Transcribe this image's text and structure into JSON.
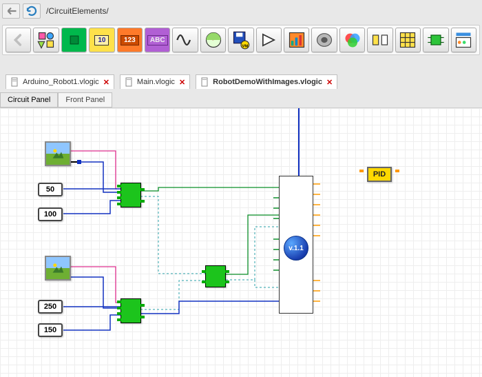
{
  "path": "/CircuitElements/",
  "tabs": [
    {
      "label": "Arduino_Robot1.vlogic"
    },
    {
      "label": "Main.vlogic"
    },
    {
      "label": "RobotDemoWithImages.vlogic"
    }
  ],
  "panel_tabs": {
    "circuit": "Circuit Panel",
    "front": "Front Panel"
  },
  "numbers": {
    "n50": "50",
    "n100": "100",
    "n250": "250",
    "n150": "150"
  },
  "pid_label": "PID",
  "version_badge": "v.1.1",
  "toolbar_labels": {
    "ten": "10",
    "onetwothree": "123",
    "abc": "ABC"
  }
}
